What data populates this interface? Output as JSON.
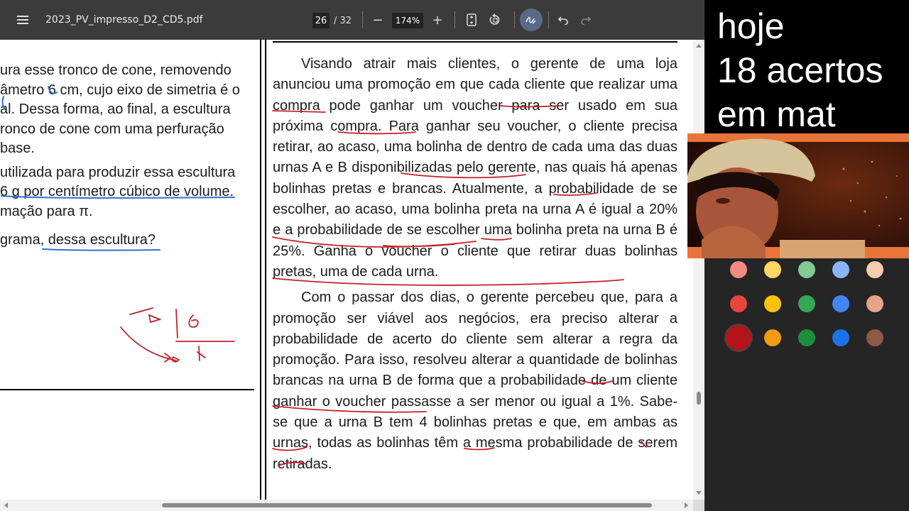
{
  "toolbar": {
    "filename": "2023_PV_impresso_D2_CD5.pdf",
    "page_current": "26",
    "page_total": "/ 32",
    "zoom_minus": "−",
    "zoom_level": "174%",
    "zoom_plus": "+"
  },
  "left_column": {
    "lines": [
      "ura esse tronco de cone, removendo",
      "âmetro 6 cm, cujo eixo de simetria é o",
      "al. Dessa forma, ao final, a escultura",
      "ronco de cone com uma perfuração",
      "base.",
      "utilizada para produzir essa escultura",
      "6 g por centímetro cúbico de volume.",
      "mação para π.",
      "grama, dessa escultura?"
    ]
  },
  "right_column": {
    "paragraph1": "Visando atrair mais clientes, o gerente de uma loja anunciou uma promoção em que cada cliente que realizar uma compra pode ganhar um voucher para ser usado em sua próxima compra. Para ganhar seu voucher, o cliente precisa retirar, ao acaso, uma bolinha de dentro de cada uma das duas urnas A e B disponibilizadas pelo gerente, nas quais há apenas bolinhas pretas e brancas. Atualmente, a probabilidade de se escolher, ao acaso, uma bolinha preta na urna A é igual a 20% e a probabilidade de se escolher uma bolinha preta na urna B é 25%. Ganha o voucher o cliente que retirar duas bolinhas pretas, uma de cada urna.",
    "paragraph2": "Com o passar dos dias, o gerente percebeu que, para a promoção ser viável aos negócios, era preciso alterar a probabilidade de acerto do cliente sem alterar a regra da promoção. Para isso, resolveu alterar a quantidade de bolinhas brancas na urna B de forma que a probabilidade de um cliente ganhar o voucher passasse a ser menor ou igual a 1%. Sabe-se que a urna B tem 4 bolinhas pretas e que, em ambas as urnas, todas as bolinhas têm a mesma probabilidade de serem retiradas."
  },
  "overlay": {
    "line1": "hoje",
    "line2": "18 acertos",
    "line3": "em mat"
  },
  "palette_colors": [
    "#f28b82",
    "#fdd663",
    "#81c995",
    "#8ab4f8",
    "#f6cbb0",
    "#e8453c",
    "#f9c20a",
    "#34a853",
    "#4285f4",
    "#e6a58a",
    "#b3141c",
    "#ef9c12",
    "#1e8e3e",
    "#1a73e8",
    "#8d5a46"
  ],
  "icons": {
    "menu": "hamburger-menu-icon",
    "fit_page": "fit-page-icon",
    "rotate": "rotate-icon",
    "draw": "draw-icon",
    "undo": "undo-icon",
    "redo": "redo-icon"
  }
}
